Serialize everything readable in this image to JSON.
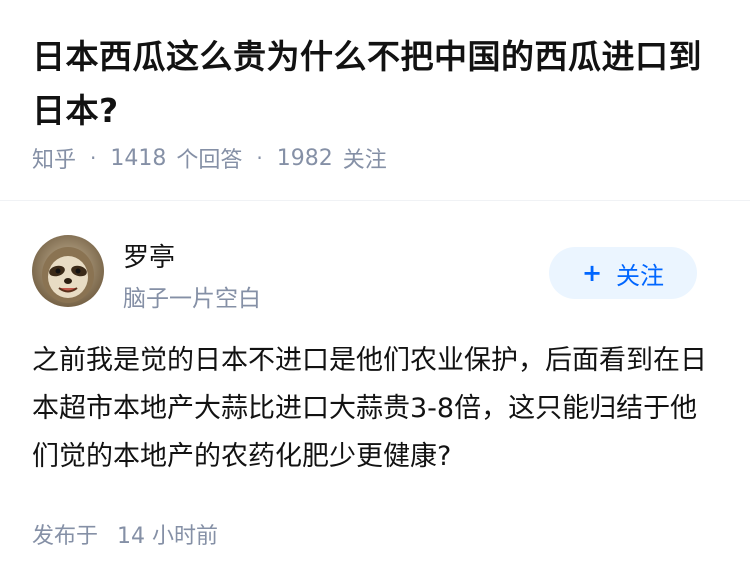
{
  "question": {
    "title": "日本西瓜这么贵为什么不把中国的西瓜进口到日本?",
    "source": "知乎",
    "answers_count": "1418",
    "answers_label": "个回答",
    "followers_count": "1982",
    "followers_label": "关注",
    "separator": "·"
  },
  "answer": {
    "author": {
      "name": "罗亭",
      "bio": "脑子一片空白",
      "avatar_icon": "sloth-avatar"
    },
    "follow_button": {
      "icon": "plus-icon",
      "plus": "+",
      "label": "关注"
    },
    "content": "之前我是觉的日本不进口是他们农业保护，后面看到在日本超市本地产大蒜比进口大蒜贵3-8倍，这只能归结于他们觉的本地产的农药化肥少更健康?",
    "published_label": "发布于",
    "published_time": "14 小时前"
  },
  "colors": {
    "text": "#121212",
    "meta": "#8590a6",
    "accent": "#0066ff",
    "button_bg": "#ebf5ff"
  }
}
